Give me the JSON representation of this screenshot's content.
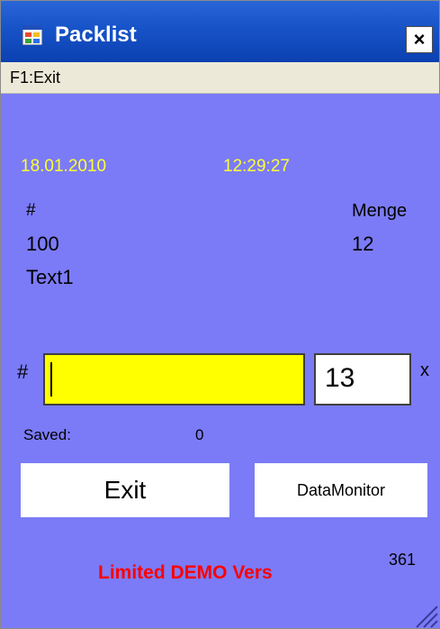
{
  "window": {
    "title": "Packlist",
    "close_glyph": "×",
    "icon": "app-window-icon",
    "bg_color": "#7b7bf7"
  },
  "menu": {
    "items": [
      {
        "label": "F1:Exit"
      }
    ]
  },
  "header": {
    "date": "18.01.2010",
    "time": "12:29:27"
  },
  "record": {
    "number_label": "#",
    "number_value": "100",
    "quantity_label": "Menge",
    "quantity_value": "12",
    "text": "Text1"
  },
  "scan": {
    "hash_label": "#",
    "input_value": "",
    "input_color": "#ffff00",
    "qty_value": "13",
    "qty_suffix": "x"
  },
  "saved": {
    "label": "Saved:",
    "count": "0"
  },
  "buttons": {
    "exit_label": "Exit",
    "datamonitor_label": "DataMonitor"
  },
  "footer": {
    "demo_text": "Limited DEMO Vers",
    "demo_color": "#ff0000",
    "counter": "361"
  }
}
